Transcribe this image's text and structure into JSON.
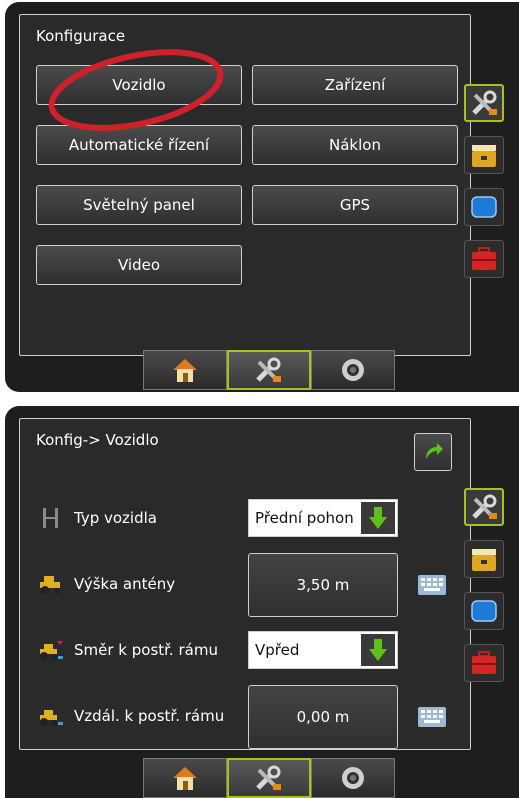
{
  "config_screen": {
    "title": "Konfigurace",
    "buttons": [
      "Vozidlo",
      "Zařízení",
      "Automatické řízení",
      "Náklon",
      "Světelný panel",
      "GPS",
      "Video"
    ],
    "highlighted_button": "Vozidlo",
    "highlight_color": "#d0202a"
  },
  "vehicle_screen": {
    "title": "Konfig-> Vozidlo",
    "rows": [
      {
        "label": "Typ vozidla",
        "value": "Přední pohon",
        "control": "dropdown",
        "icon": "steering-type-icon"
      },
      {
        "label": "Výška antény",
        "value": "3,50 m",
        "control": "keypad",
        "icon": "tractor-icon"
      },
      {
        "label": "Směr k postř. rámu",
        "value": "Vpřed",
        "control": "dropdown",
        "icon": "tractor-direction-icon"
      },
      {
        "label": "Vzdál. k postř. rámu",
        "value": "0,00 m",
        "control": "keypad",
        "icon": "tractor-distance-icon"
      }
    ]
  },
  "side_tabs": [
    "tools-icon",
    "implement-icon",
    "screen-icon",
    "toolbox-icon"
  ],
  "bottom_tabs": [
    "home-icon",
    "tools-icon",
    "camera-icon"
  ],
  "colors": {
    "accent": "#a9c21a",
    "dropdown_arrow": "#5fbf1c"
  }
}
